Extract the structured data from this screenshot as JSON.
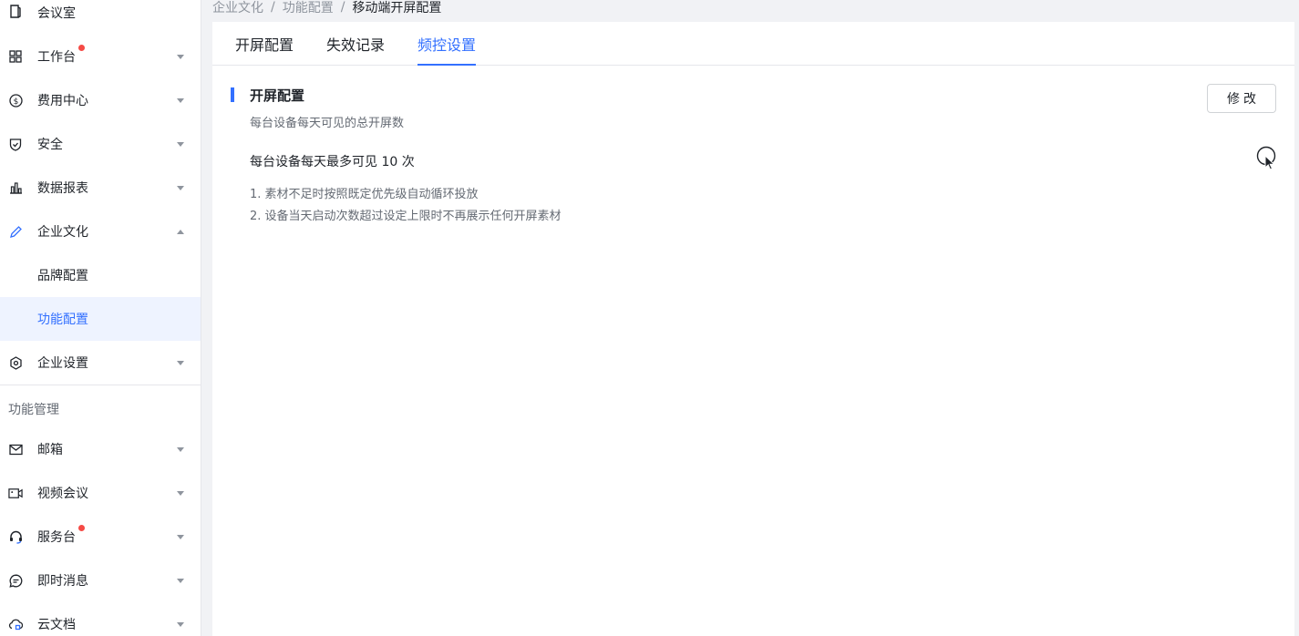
{
  "sidebar": {
    "meeting_room": "会议室",
    "workbench": "工作台",
    "cost_center": "费用中心",
    "security": "安全",
    "reports": "数据报表",
    "culture": "企业文化",
    "brand_config": "品牌配置",
    "feature_config": "功能配置",
    "enterprise_settings": "企业设置",
    "section_label": "功能管理",
    "mail": "邮箱",
    "video_meeting": "视频会议",
    "service_desk": "服务台",
    "im": "即时消息",
    "cloud_docs": "云文档"
  },
  "breadcrumb": {
    "level1": "企业文化",
    "level2": "功能配置",
    "current": "移动端开屏配置",
    "separator": "/"
  },
  "tabs": [
    {
      "label": "开屏配置"
    },
    {
      "label": "失效记录"
    },
    {
      "label": "频控设置"
    }
  ],
  "active_tab": "频控设置",
  "section": {
    "title": "开屏配置",
    "subtitle": "每台设备每天可见的总开屏数",
    "limit_text": "每台设备每天最多可见 10 次",
    "rules": [
      "1. 素材不足时按照既定优先级自动循环投放",
      "2. 设备当天启动次数超过设定上限时不再展示任何开屏素材"
    ],
    "edit_button": "修改"
  },
  "colors": {
    "accent": "#3370ff",
    "badge": "#f54a45",
    "background": "#f1f2f5"
  }
}
